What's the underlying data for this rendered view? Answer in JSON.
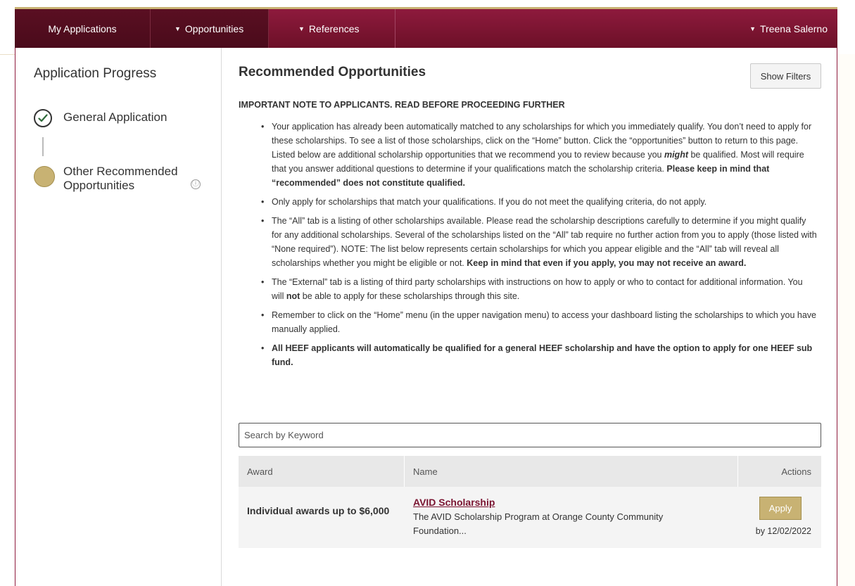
{
  "nav": {
    "my_applications": "My Applications",
    "opportunities": "Opportunities",
    "references": "References",
    "user": "Treena Salerno",
    "caret": "▼"
  },
  "sidebar": {
    "title": "Application Progress",
    "steps": [
      {
        "label": "General Application",
        "status": "complete"
      },
      {
        "label": "Other Recommended Opportunities",
        "status": "current"
      }
    ],
    "info_icon": "ⓘ"
  },
  "main": {
    "title": "Recommended Opportunities",
    "show_filters": "Show Filters",
    "important_note": "IMPORTANT NOTE TO APPLICANTS. READ BEFORE PROCEEDING FURTHER",
    "notes": [
      {
        "a": "Your application has already been automatically matched to any scholarships for which you immediately qualify. You don’t need to apply for these scholarships. To see a list of those scholarships, click on the “Home” button. Click the “opportunities” button to return to this page. Listed below are additional scholarship opportunities that we recommend you to review because you ",
        "em": "might",
        "b": " be qualified. Most will require that you answer additional questions to determine if your qualifications match the scholarship criteria. ",
        "strong": "Please keep in mind that “recommended” does not constitute qualified."
      },
      {
        "a": "Only apply for scholarships that match your qualifications. If you do not meet the qualifying criteria, do not apply."
      },
      {
        "a": "The “All” tab is a listing of other scholarships available. Please read the scholarship descriptions carefully to determine if you might qualify for any additional scholarships. Several of the scholarships listed on the “All” tab require no further action from you to apply (those listed with “None required”). NOTE: The list below represents certain scholarships for which you appear eligible and the “All” tab will reveal all scholarships whether you might be eligible or not. ",
        "strong": "Keep in mind that even if you apply, you may not receive an award."
      },
      {
        "a": "The “External” tab is a listing of third party scholarships with instructions on how to apply or who to contact for additional information. You will ",
        "strong": "not",
        "b": " be able to apply for these scholarships through this site."
      },
      {
        "a": "Remember to click on the “Home” menu (in the upper navigation menu) to access your dashboard listing the scholarships to which you have manually applied."
      },
      {
        "strong": "All HEEF applicants will automatically be qualified for a general HEEF scholarship and have the option to apply for one HEEF sub fund."
      }
    ],
    "search_placeholder": "Search by Keyword",
    "table": {
      "headers": {
        "award": "Award",
        "name": "Name",
        "actions": "Actions"
      },
      "rows": [
        {
          "award": "Individual awards up to $6,000",
          "name": "AVID Scholarship",
          "description": "The AVID Scholarship Program at Orange County Community Foundation...",
          "action": "Apply",
          "deadline": "by 12/02/2022"
        }
      ]
    }
  },
  "colors": {
    "brand": "#7a1431",
    "accent_gold": "#c8b273"
  },
  "icons": {
    "check": "check-circle-icon",
    "info": "info-icon",
    "caret": "caret-down-icon"
  }
}
